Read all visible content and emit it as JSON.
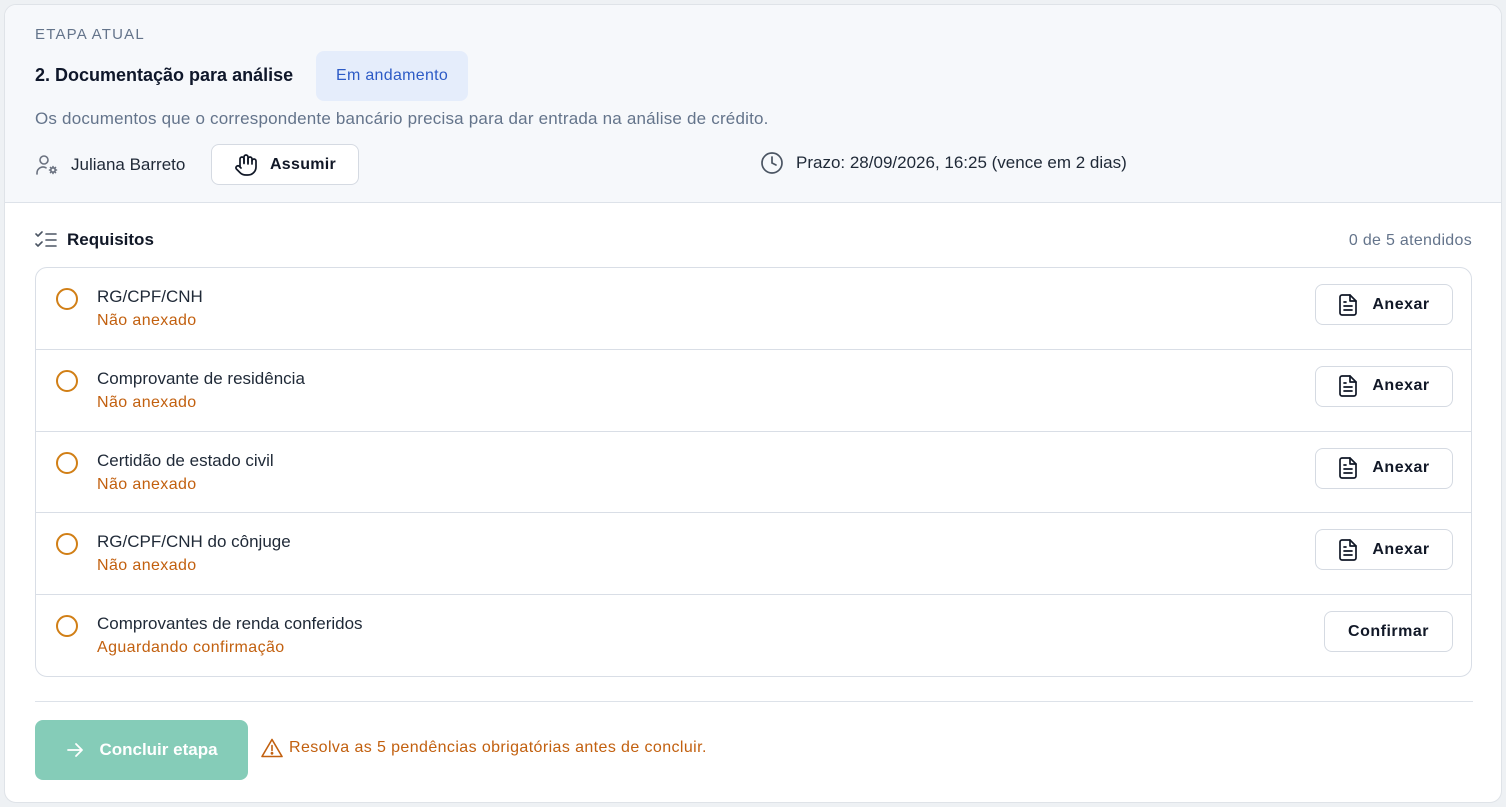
{
  "header": {
    "eyebrow": "ETAPA ATUAL",
    "title": "2. Documentação para análise",
    "status_badge": "Em andamento",
    "description": "Os documentos que o correspondente bancário precisa para dar entrada na análise de crédito.",
    "assignee": "Juliana Barreto",
    "assume_label": "Assumir",
    "deadline": "Prazo: 28/09/2026, 16:25 (vence em 2 dias)"
  },
  "requirements": {
    "title": "Requisitos",
    "count": "0 de 5 atendidos",
    "items": [
      {
        "label": "RG/CPF/CNH",
        "state": "Não anexado",
        "action": "Anexar"
      },
      {
        "label": "Comprovante de residência",
        "state": "Não anexado",
        "action": "Anexar"
      },
      {
        "label": "Certidão de estado civil",
        "state": "Não anexado",
        "action": "Anexar"
      },
      {
        "label": "RG/CPF/CNH do cônjuge",
        "state": "Não anexado",
        "action": "Anexar"
      },
      {
        "label": "Comprovantes de renda conferidos",
        "state": "Aguardando confirmação",
        "action": "Confirmar"
      }
    ]
  },
  "footer": {
    "conclude_label": "Concluir etapa",
    "warning": "Resolva as 5 pendências obrigatórias antes de concluir."
  },
  "colors": {
    "accent_green": "#85ccb8",
    "warning_orange": "#c2600f",
    "badge_bg": "#e5edfb",
    "badge_text": "#2d5bc6"
  },
  "icons": [
    "user-settings-icon",
    "hand-icon",
    "clock-icon",
    "checklist-icon",
    "document-icon",
    "arrow-right-icon",
    "warning-icon"
  ]
}
